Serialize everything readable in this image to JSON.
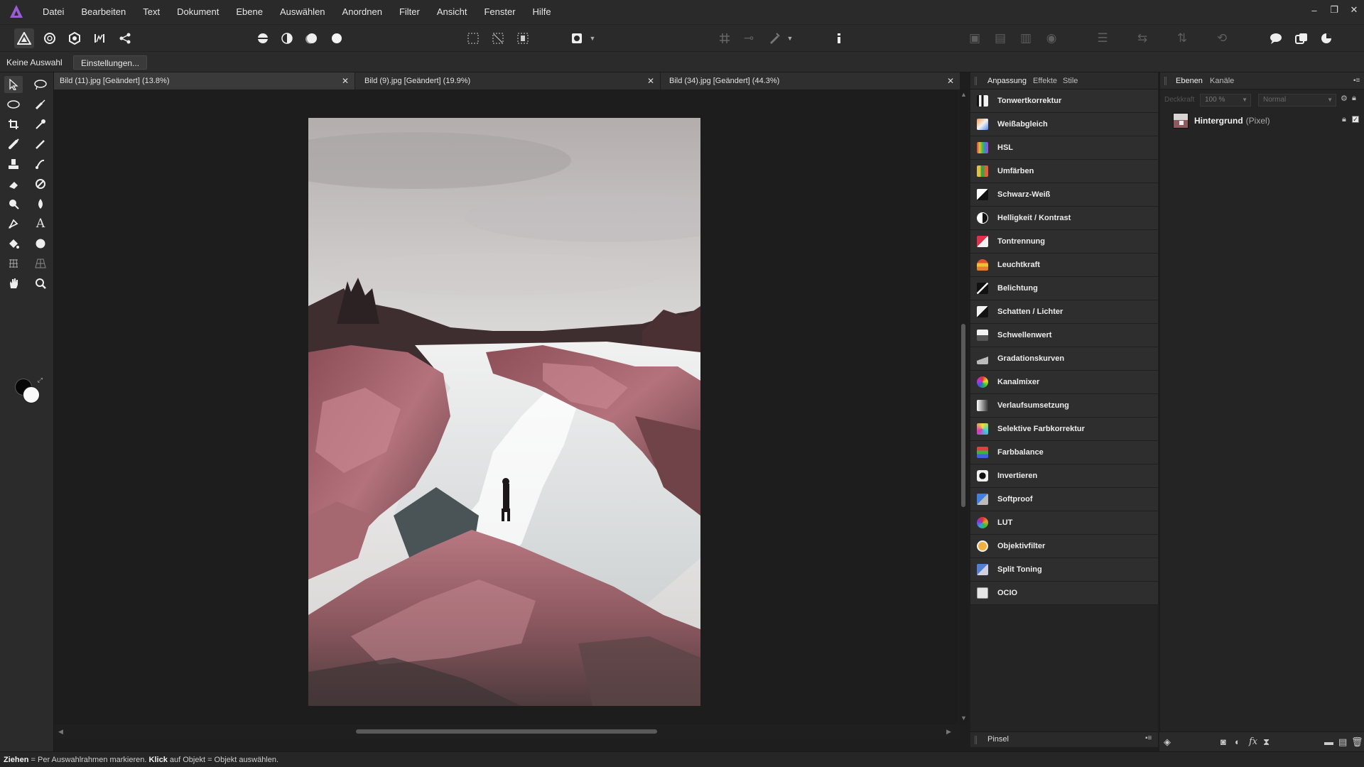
{
  "menu": [
    "Datei",
    "Bearbeiten",
    "Text",
    "Dokument",
    "Ebene",
    "Auswählen",
    "Anordnen",
    "Filter",
    "Ansicht",
    "Fenster",
    "Hilfe"
  ],
  "window_controls": {
    "minimize": "–",
    "restore": "❐",
    "close": "✕"
  },
  "context_bar": {
    "selection": "Keine Auswahl",
    "settings_button": "Einstellungen..."
  },
  "doc_tabs": [
    {
      "title": "Bild (11).jpg [Geändert] (13.8%)",
      "close": "✕"
    },
    {
      "title": "Bild (9).jpg [Geändert] (19.9%)",
      "close": "✕"
    },
    {
      "title": "Bild (34).jpg [Geändert] (44.3%)",
      "close": "✕"
    }
  ],
  "adjustment_panel": {
    "tabs": [
      "Anpassung",
      "Effekte",
      "Stile"
    ],
    "items": [
      {
        "label": "Tonwertkorrektur",
        "icon": "levels-icon"
      },
      {
        "label": "Weißabgleich",
        "icon": "white-balance-icon"
      },
      {
        "label": "HSL",
        "icon": "hsl-icon"
      },
      {
        "label": "Umfärben",
        "icon": "recolor-icon"
      },
      {
        "label": "Schwarz-Weiß",
        "icon": "black-white-icon"
      },
      {
        "label": "Helligkeit / Kontrast",
        "icon": "brightness-contrast-icon"
      },
      {
        "label": "Tontrennung",
        "icon": "posterize-icon"
      },
      {
        "label": "Leuchtkraft",
        "icon": "vibrance-icon"
      },
      {
        "label": "Belichtung",
        "icon": "exposure-icon"
      },
      {
        "label": "Schatten / Lichter",
        "icon": "shadows-highlights-icon"
      },
      {
        "label": "Schwellenwert",
        "icon": "threshold-icon"
      },
      {
        "label": "Gradationskurven",
        "icon": "curves-icon"
      },
      {
        "label": "Kanalmixer",
        "icon": "channel-mixer-icon"
      },
      {
        "label": "Verlaufsumsetzung",
        "icon": "gradient-map-icon"
      },
      {
        "label": "Selektive Farbkorrektur",
        "icon": "selective-colour-icon"
      },
      {
        "label": "Farbbalance",
        "icon": "colour-balance-icon"
      },
      {
        "label": "Invertieren",
        "icon": "invert-icon"
      },
      {
        "label": "Softproof",
        "icon": "soft-proof-icon"
      },
      {
        "label": "LUT",
        "icon": "lut-icon"
      },
      {
        "label": "Objektivfilter",
        "icon": "lens-filter-icon"
      },
      {
        "label": "Split Toning",
        "icon": "split-toning-icon"
      },
      {
        "label": "OCIO",
        "icon": "ocio-icon"
      }
    ],
    "bottom_label": "Pinsel"
  },
  "layers_panel": {
    "tabs": [
      "Ebenen",
      "Kanäle"
    ],
    "opacity_label": "Deckkraft",
    "opacity": "100 %",
    "blend_mode": "Normal",
    "layer": {
      "name": "Hintergrund",
      "type": "(Pixel)"
    }
  },
  "status": {
    "k1": "Ziehen",
    "t1": " = Per Auswahlrahmen markieren. ",
    "k2": "Klick",
    "t2": " auf Objekt = Objekt auswählen."
  },
  "colors": {
    "accent": "#9b5cd6",
    "ui_background": "#2a2a2a",
    "panel": "#2e2e2e"
  }
}
